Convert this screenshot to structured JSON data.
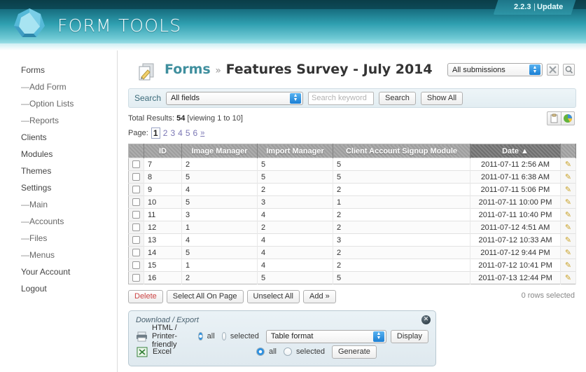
{
  "header": {
    "brand": "FORM TOOLS",
    "version": "2.2.3",
    "separator": "|",
    "update_label": "Update",
    "logo_icon": "dodecahedron-logo"
  },
  "sidebar": {
    "items": [
      {
        "label": "Forms",
        "sub": false
      },
      {
        "label": "Add Form",
        "sub": true
      },
      {
        "label": "Option Lists",
        "sub": true
      },
      {
        "label": "Reports",
        "sub": true
      },
      {
        "label": "Clients",
        "sub": false
      },
      {
        "label": "Modules",
        "sub": false
      },
      {
        "label": "Themes",
        "sub": false
      },
      {
        "label": "Settings",
        "sub": false
      },
      {
        "label": "Main",
        "sub": true
      },
      {
        "label": "Accounts",
        "sub": true
      },
      {
        "label": "Files",
        "sub": true
      },
      {
        "label": "Menus",
        "sub": true
      },
      {
        "label": "Your Account",
        "sub": false
      },
      {
        "label": "Logout",
        "sub": false
      }
    ],
    "dash": "—"
  },
  "title": {
    "icon": "form-edit-icon",
    "breadcrumb": "Forms",
    "arrow": "»",
    "current": "Features Survey - July 2014"
  },
  "submissions": {
    "selected": "All submissions",
    "tools_icon": "wrench-cross-icon",
    "search_icon": "magnifier-icon"
  },
  "search": {
    "label": "Search",
    "field_selected": "All fields",
    "keyword_value": "",
    "keyword_placeholder": "Search keyword",
    "search_button": "Search",
    "show_all_button": "Show All"
  },
  "results": {
    "prefix": "Total Results:",
    "total": "54",
    "viewing": "[viewing 1 to 10]",
    "page_label": "Page:",
    "pages": [
      "1",
      "2",
      "3",
      "4",
      "5",
      "6"
    ],
    "current_page": "1",
    "next_symbol": "»",
    "clipboard_icon": "clipboard-icon",
    "chart_icon": "pie-chart-icon"
  },
  "table": {
    "columns": [
      "ID",
      "Image Manager",
      "Import Manager",
      "Client Account Signup Module",
      "Date"
    ],
    "sorted_column": "Date",
    "sort_direction": "▲",
    "edit_icon": "pencil-icon",
    "rows": [
      {
        "id": "7",
        "image_manager": "2",
        "import_manager": "5",
        "client_account": "5",
        "date": "2011-07-11 2:56 AM"
      },
      {
        "id": "8",
        "image_manager": "5",
        "import_manager": "5",
        "client_account": "5",
        "date": "2011-07-11 6:38 AM"
      },
      {
        "id": "9",
        "image_manager": "4",
        "import_manager": "2",
        "client_account": "2",
        "date": "2011-07-11 5:06 PM"
      },
      {
        "id": "10",
        "image_manager": "5",
        "import_manager": "3",
        "client_account": "1",
        "date": "2011-07-11 10:00 PM"
      },
      {
        "id": "11",
        "image_manager": "3",
        "import_manager": "4",
        "client_account": "2",
        "date": "2011-07-11 10:40 PM"
      },
      {
        "id": "12",
        "image_manager": "1",
        "import_manager": "2",
        "client_account": "2",
        "date": "2011-07-12 4:51 AM"
      },
      {
        "id": "13",
        "image_manager": "4",
        "import_manager": "4",
        "client_account": "3",
        "date": "2011-07-12 10:33 AM"
      },
      {
        "id": "14",
        "image_manager": "5",
        "import_manager": "4",
        "client_account": "2",
        "date": "2011-07-12 9:44 PM"
      },
      {
        "id": "15",
        "image_manager": "1",
        "import_manager": "4",
        "client_account": "2",
        "date": "2011-07-12 10:41 PM"
      },
      {
        "id": "16",
        "image_manager": "2",
        "import_manager": "5",
        "client_account": "5",
        "date": "2011-07-13 12:44 PM"
      }
    ]
  },
  "actions": {
    "delete": "Delete",
    "select_all": "Select All On Page",
    "unselect_all": "Unselect All",
    "add": "Add »",
    "rows_selected": "0 rows selected"
  },
  "export": {
    "title": "Download / Export",
    "close": "✕",
    "rows": [
      {
        "icon": "printer-icon",
        "label": "HTML / Printer-friendly",
        "all_label": "all",
        "selected_label": "selected",
        "scope": "all",
        "format": "Table format",
        "button": "Display"
      },
      {
        "icon": "excel-icon",
        "label": "Excel",
        "all_label": "all",
        "selected_label": "selected",
        "scope": "all",
        "format": null,
        "button": "Generate"
      }
    ]
  },
  "colors": {
    "brand_teal": "#2f9fb0",
    "header_dark": "#0a3d48",
    "link_purple": "#7b77b5",
    "crumb_teal": "#3f8f9e",
    "delete_red": "#cc4444",
    "radio_blue": "#2a8fe0"
  }
}
